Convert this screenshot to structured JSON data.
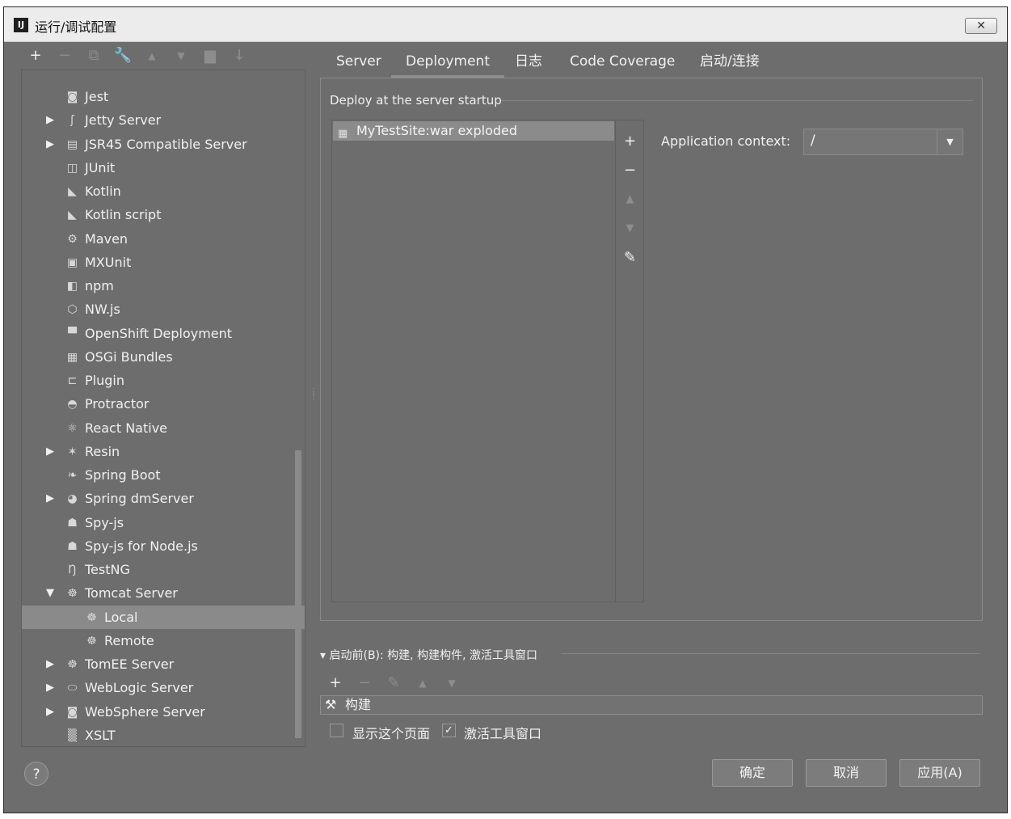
{
  "window": {
    "title": "运行/调试配置",
    "close_glyph": "✕"
  },
  "left_toolbar": [
    {
      "name": "add-config-button",
      "glyph": "+",
      "enabled": true
    },
    {
      "name": "remove-config-button",
      "glyph": "−",
      "enabled": false
    },
    {
      "name": "copy-config-button",
      "glyph": "⧉",
      "enabled": false
    },
    {
      "name": "edit-defaults-button",
      "glyph": "🔧",
      "enabled": true
    },
    {
      "name": "move-up-button",
      "glyph": "▲",
      "enabled": false
    },
    {
      "name": "move-down-button",
      "glyph": "▼",
      "enabled": false
    },
    {
      "name": "folder-button",
      "glyph": "▆",
      "enabled": false
    },
    {
      "name": "sort-button",
      "glyph": "↓",
      "enabled": false
    }
  ],
  "tree": {
    "items": [
      {
        "label": "Jest",
        "icon": "jest-icon",
        "glyph": "◙",
        "indent": 1,
        "arrow": ""
      },
      {
        "label": "Jetty Server",
        "icon": "jetty-icon",
        "glyph": "ʃ",
        "indent": 1,
        "arrow": "▶"
      },
      {
        "label": "JSR45 Compatible Server",
        "icon": "server-icon",
        "glyph": "▤",
        "indent": 1,
        "arrow": "▶"
      },
      {
        "label": "JUnit",
        "icon": "junit-icon",
        "glyph": "◫",
        "indent": 1,
        "arrow": ""
      },
      {
        "label": "Kotlin",
        "icon": "kotlin-icon",
        "glyph": "◣",
        "indent": 1,
        "arrow": ""
      },
      {
        "label": "Kotlin script",
        "icon": "kotlin-script-icon",
        "glyph": "◣",
        "indent": 1,
        "arrow": ""
      },
      {
        "label": "Maven",
        "icon": "maven-gear-icon",
        "glyph": "⚙",
        "indent": 1,
        "arrow": ""
      },
      {
        "label": "MXUnit",
        "icon": "mxunit-icon",
        "glyph": "▣",
        "indent": 1,
        "arrow": ""
      },
      {
        "label": "npm",
        "icon": "npm-icon",
        "glyph": "◧",
        "indent": 1,
        "arrow": ""
      },
      {
        "label": "NW.js",
        "icon": "nwjs-icon",
        "glyph": "⬡",
        "indent": 1,
        "arrow": ""
      },
      {
        "label": "OpenShift Deployment",
        "icon": "openshift-icon",
        "glyph": "▀",
        "indent": 1,
        "arrow": ""
      },
      {
        "label": "OSGi Bundles",
        "icon": "osgi-icon",
        "glyph": "▦",
        "indent": 1,
        "arrow": ""
      },
      {
        "label": "Plugin",
        "icon": "plugin-icon",
        "glyph": "⊏",
        "indent": 1,
        "arrow": ""
      },
      {
        "label": "Protractor",
        "icon": "protractor-icon",
        "glyph": "◓",
        "indent": 1,
        "arrow": ""
      },
      {
        "label": "React Native",
        "icon": "react-icon",
        "glyph": "⚛",
        "indent": 1,
        "arrow": ""
      },
      {
        "label": "Resin",
        "icon": "resin-icon",
        "glyph": "✶",
        "indent": 1,
        "arrow": "▶"
      },
      {
        "label": "Spring Boot",
        "icon": "spring-boot-icon",
        "glyph": "❧",
        "indent": 1,
        "arrow": ""
      },
      {
        "label": "Spring dmServer",
        "icon": "spring-dm-icon",
        "glyph": "◕",
        "indent": 1,
        "arrow": "▶"
      },
      {
        "label": "Spy-js",
        "icon": "spyjs-icon",
        "glyph": "☗",
        "indent": 1,
        "arrow": ""
      },
      {
        "label": "Spy-js for Node.js",
        "icon": "spyjs-node-icon",
        "glyph": "☗",
        "indent": 1,
        "arrow": ""
      },
      {
        "label": "TestNG",
        "icon": "testng-icon",
        "glyph": "Ŋ",
        "indent": 1,
        "arrow": ""
      },
      {
        "label": "Tomcat Server",
        "icon": "tomcat-icon",
        "glyph": "☸",
        "indent": 1,
        "arrow": "▼"
      },
      {
        "label": "Local",
        "icon": "tomcat-icon",
        "glyph": "☸",
        "indent": 2,
        "arrow": "",
        "selected": true
      },
      {
        "label": "Remote",
        "icon": "tomcat-icon",
        "glyph": "☸",
        "indent": 2,
        "arrow": ""
      },
      {
        "label": "TomEE Server",
        "icon": "tomee-icon",
        "glyph": "☸",
        "indent": 1,
        "arrow": "▶"
      },
      {
        "label": "WebLogic Server",
        "icon": "weblogic-icon",
        "glyph": "⬭",
        "indent": 1,
        "arrow": "▶"
      },
      {
        "label": "WebSphere Server",
        "icon": "websphere-icon",
        "glyph": "◙",
        "indent": 1,
        "arrow": "▶"
      },
      {
        "label": "XSLT",
        "icon": "xslt-icon",
        "glyph": "▒",
        "indent": 1,
        "arrow": ""
      }
    ]
  },
  "tabs": [
    {
      "label": "Server",
      "active": false
    },
    {
      "label": "Deployment",
      "active": true
    },
    {
      "label": "日志",
      "active": false
    },
    {
      "label": "Code Coverage",
      "active": false
    },
    {
      "label": "启动/连接",
      "active": false
    }
  ],
  "deployment": {
    "group_label": "Deploy at the server startup",
    "artifact": {
      "label": "MyTestSite:war exploded",
      "icon": "artifact-icon"
    },
    "side_buttons": [
      {
        "name": "add-artifact-button",
        "glyph": "+",
        "enabled": true
      },
      {
        "name": "remove-artifact-button",
        "glyph": "−",
        "enabled": true
      },
      {
        "name": "move-up-artifact-button",
        "glyph": "▲",
        "enabled": false
      },
      {
        "name": "move-down-artifact-button",
        "glyph": "▼",
        "enabled": false
      },
      {
        "name": "edit-artifact-button",
        "glyph": "✎",
        "enabled": true
      }
    ],
    "app_context_label": "Application context:",
    "app_context_value": "/"
  },
  "before_launch": {
    "label": "▾ 启动前(B): 构建, 构建构件, 激活工具窗口",
    "toolbar": [
      {
        "name": "add-task-button",
        "glyph": "+",
        "enabled": true
      },
      {
        "name": "remove-task-button",
        "glyph": "−",
        "enabled": false
      },
      {
        "name": "edit-task-button",
        "glyph": "✎",
        "enabled": false
      },
      {
        "name": "task-up-button",
        "glyph": "▲",
        "enabled": false
      },
      {
        "name": "task-down-button",
        "glyph": "▼",
        "enabled": false
      }
    ],
    "task": {
      "label": "构建",
      "icon_glyph": "⚒"
    },
    "show_page_label": "显示这个页面",
    "show_page_checked": false,
    "activate_window_label": "激活工具窗口",
    "activate_window_checked": true
  },
  "footer": {
    "help": "?",
    "ok": "确定",
    "cancel": "取消",
    "apply": "应用(A)"
  }
}
